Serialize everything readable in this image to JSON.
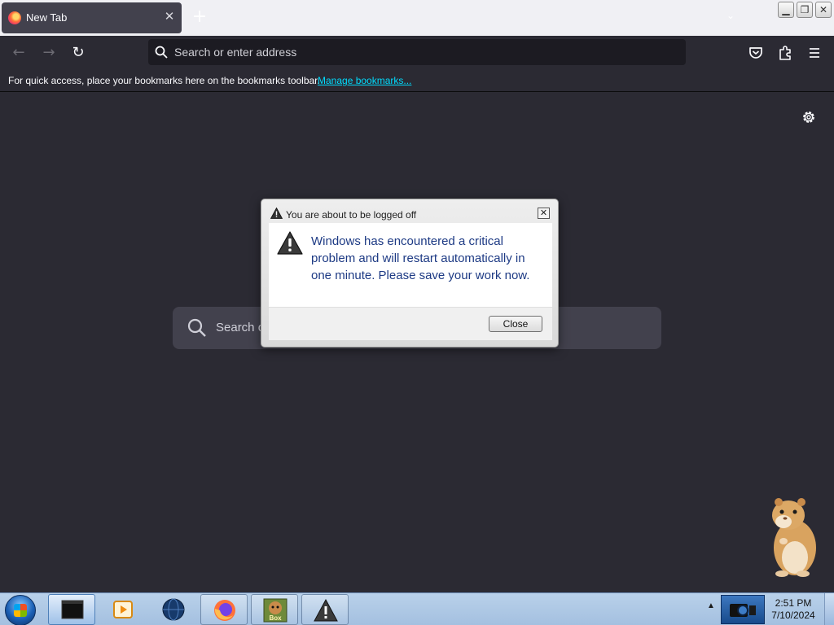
{
  "browser": {
    "tab": {
      "title": "New Tab",
      "close_glyph": "✕"
    },
    "new_tab_glyph": "+",
    "tab_list_glyph": "⌄",
    "window_controls": {
      "minimize": "▁",
      "maximize": "❐",
      "close": "✕"
    },
    "nav": {
      "back": "←",
      "forward": "→",
      "reload": "↻"
    },
    "urlbar": {
      "placeholder": "Search or enter address",
      "value": ""
    },
    "toolbar_icons": [
      "pocket-icon",
      "extensions-icon",
      "menu-icon"
    ],
    "bookmarks_bar": {
      "text": "For quick access, place your bookmarks here on the bookmarks toolbar.",
      "link": "Manage bookmarks..."
    }
  },
  "newtab": {
    "search_placeholder": "Search o",
    "settings_icon": "gear-icon"
  },
  "dialog": {
    "title": "You are about to be logged off",
    "close_glyph": "✕",
    "message": "Windows has encountered a critical problem and will restart automatically in one minute. Please save your work now.",
    "button": "Close"
  },
  "taskbar": {
    "buttons": [
      "terminal",
      "media-player",
      "globe",
      "firefox",
      "boxed-game",
      "warning"
    ],
    "button_label_box": "Box",
    "tray_arrow": "▲",
    "clock": {
      "time": "2:51 PM",
      "date": "7/10/2024"
    }
  },
  "colors": {
    "content_bg": "#2b2a33",
    "urlbar_bg": "#1c1b22",
    "link": "#00ddff",
    "dialog_text": "#1d3a84",
    "taskbar": "#a4c0e0"
  }
}
